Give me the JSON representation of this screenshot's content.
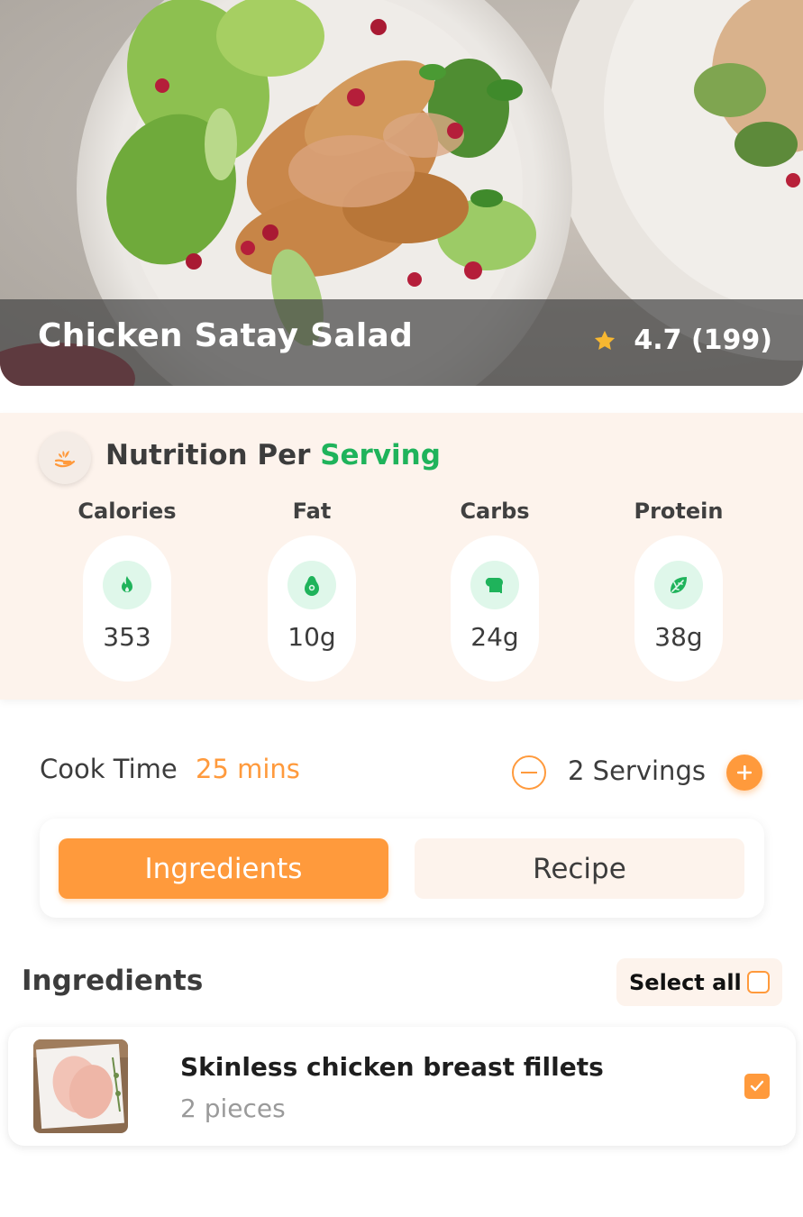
{
  "recipe": {
    "title": "Chicken Satay Salad",
    "rating": "4.7 (199)",
    "star_icon": "star-icon"
  },
  "nutrition": {
    "title_prefix": "Nutrition Per ",
    "title_highlight": "Serving",
    "badge_icon": "hand-leaf-icon",
    "items": [
      {
        "label": "Calories",
        "value": "353",
        "icon": "flame-icon"
      },
      {
        "label": "Fat",
        "value": "10g",
        "icon": "avocado-icon"
      },
      {
        "label": "Carbs",
        "value": "24g",
        "icon": "bread-icon"
      },
      {
        "label": "Protein",
        "value": "38g",
        "icon": "leaf-icon"
      }
    ]
  },
  "cook": {
    "label": "Cook Time",
    "value": "25 mins",
    "servings": "2 Servings"
  },
  "tabs": {
    "active": "Ingredients",
    "inactive": "Recipe"
  },
  "ingredients": {
    "heading": "Ingredients",
    "select_all": "Select all",
    "items": [
      {
        "name": "Skinless chicken breast fillets",
        "quantity": "2 pieces",
        "checked": true
      }
    ]
  },
  "colors": {
    "accent_orange": "#ff9a3c",
    "accent_green": "#1fb35b",
    "cream": "#fdf3ec"
  }
}
